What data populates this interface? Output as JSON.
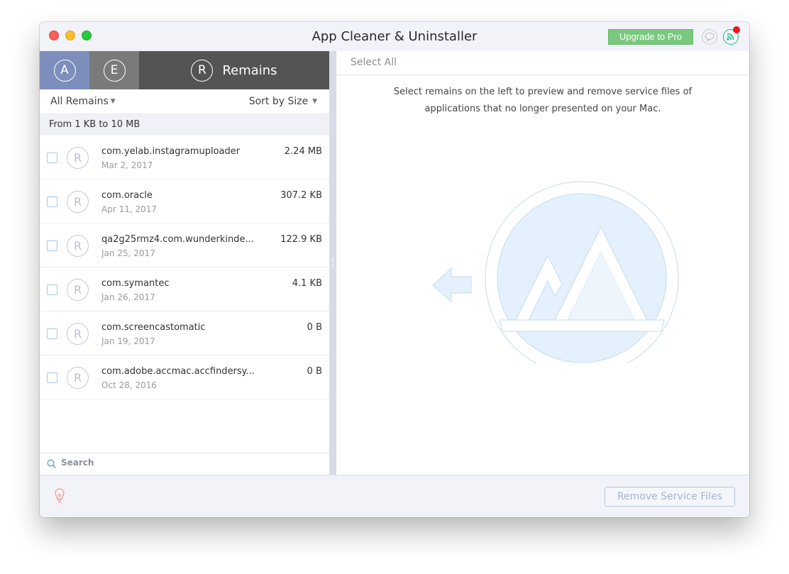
{
  "window": {
    "title": "App Cleaner & Uninstaller",
    "upgrade_label": "Upgrade to Pro",
    "icons": {
      "feedback": "speech-bubble-icon",
      "news": "rss-icon",
      "notification_dot": true
    }
  },
  "tabs": [
    {
      "name": "applications",
      "glyph": "A",
      "icon": "app-store-icon",
      "color": "#7d8ebd"
    },
    {
      "name": "extensions",
      "glyph": "E",
      "icon": "extensions-icon",
      "color": "#7a7a7a"
    },
    {
      "name": "remains",
      "glyph": "R",
      "icon": "remains-icon",
      "label": "Remains",
      "color": "#545454",
      "active": true
    }
  ],
  "filter": {
    "left": "All Remains",
    "right": "Sort by Size"
  },
  "group_header": "From 1 KB to 10 MB",
  "items": [
    {
      "name": "com.yelab.instagramuploader",
      "date": "Mar 2, 2017",
      "size": "2.24 MB",
      "checked": false
    },
    {
      "name": "com.oracle",
      "date": "Apr 11, 2017",
      "size": "307.2 KB",
      "checked": false
    },
    {
      "name": "qa2g25rmz4.com.wunderkinde...",
      "date": "Jan 25, 2017",
      "size": "122.9 KB",
      "checked": false
    },
    {
      "name": "com.symantec",
      "date": "Jan 26, 2017",
      "size": "4.1 KB",
      "checked": false
    },
    {
      "name": "com.screencastomatic",
      "date": "Jan 19, 2017",
      "size": "0 B",
      "checked": false
    },
    {
      "name": "com.adobe.accmac.accfindersy...",
      "date": "Oct 28, 2016",
      "size": "0 B",
      "checked": false
    }
  ],
  "item_glyph": "R",
  "search": {
    "placeholder": "Search",
    "value": ""
  },
  "right": {
    "select_all": "Select All",
    "info_line1": "Select remains on the left to preview and remove service files of",
    "info_line2": "applications that no longer presented on your Mac."
  },
  "footer": {
    "remove_label": "Remove Service Files",
    "tip_icon": "lightbulb-icon"
  },
  "colors": {
    "accent_blue": "#7d8ebd",
    "upgrade_green": "#78c97e",
    "rss_teal": "#1fb68c",
    "alert_red": "#f0141d",
    "art_fill": "#e4f1fc",
    "art_stroke": "#c4dcee"
  }
}
